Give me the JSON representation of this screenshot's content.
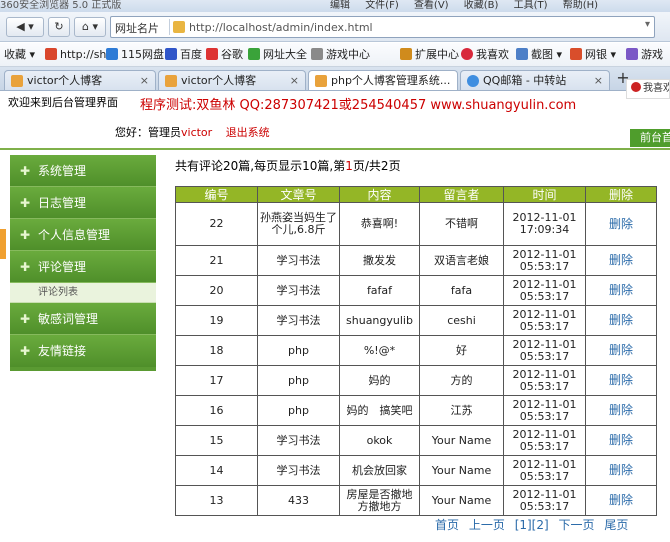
{
  "browser": {
    "app_title": "360安全浏览器 5.0 正式版",
    "menus": [
      "编辑",
      "文件(F)",
      "查看(V)",
      "收藏(B)",
      "工具(T)",
      "帮助(H)"
    ],
    "back_label": "◀",
    "home_label": "⌂",
    "sites_label": "网址名片",
    "address": "http://localhost/admin/index.html",
    "bookmarks": [
      "收藏",
      "http://sh",
      "115网盘",
      "百度",
      "谷歌",
      "网址大全",
      "游戏中心",
      "扩展中心",
      "我喜欢",
      "截图",
      "网银",
      "游戏"
    ],
    "tabs": [
      {
        "label": "victor个人博客"
      },
      {
        "label": "victor个人博客"
      },
      {
        "label": "php个人博客管理系统..."
      },
      {
        "label": "QQ邮箱 - 中转站"
      }
    ],
    "new_tab": "+",
    "badge": "我喜欢"
  },
  "colors": {
    "accent_green": "#94b626",
    "sidebar_green": "#5a9a32",
    "red_text": "#cc0000",
    "link_blue": "#2a6aa9"
  },
  "header": {
    "welcome": "欢迎来到后台管理界面",
    "slogan": "程序测试:双鱼林 QQ:287307421或254540457  www.shuangyulin.com",
    "greeting": "您好：管理员",
    "username": "victor",
    "logout": "退出系统",
    "front_link": "前台首页"
  },
  "sidebar": {
    "items": [
      {
        "label": "系统管理"
      },
      {
        "label": "日志管理"
      },
      {
        "label": "个人信息管理"
      },
      {
        "label": "评论管理"
      },
      {
        "label": "敏感词管理"
      },
      {
        "label": "友情链接"
      }
    ],
    "sub_item": "评论列表"
  },
  "summary": {
    "prefix": "共有评论",
    "total": "20",
    "mid1": "篇,每页显示",
    "per_page": "10",
    "mid2": "篇,第",
    "page": "1",
    "mid3": "页/共",
    "pages": "2",
    "suffix": "页"
  },
  "table": {
    "headers": [
      "编号",
      "文章号",
      "内容",
      "留言者",
      "时间",
      "删除"
    ],
    "rows": [
      {
        "id": "22",
        "article": "孙燕姿当妈生了个儿,6.8斤",
        "content": "恭喜啊!",
        "author": "不错啊",
        "time": "2012-11-01 17:09:34",
        "action": "删除"
      },
      {
        "id": "21",
        "article": "学习书法",
        "content": "撒发发",
        "author": "双语言老娘",
        "time": "2012-11-01 05:53:17",
        "action": "删除"
      },
      {
        "id": "20",
        "article": "学习书法",
        "content": "fafaf",
        "author": "fafa",
        "time": "2012-11-01 05:53:17",
        "action": "删除"
      },
      {
        "id": "19",
        "article": "学习书法",
        "content": "shuangyulib",
        "author": "ceshi",
        "time": "2012-11-01 05:53:17",
        "action": "删除"
      },
      {
        "id": "18",
        "article": "php",
        "content": "%!@*",
        "author": "好",
        "time": "2012-11-01 05:53:17",
        "action": "删除"
      },
      {
        "id": "17",
        "article": "php",
        "content": "妈的",
        "author": "方的",
        "time": "2012-11-01 05:53:17",
        "action": "删除"
      },
      {
        "id": "16",
        "article": "php",
        "content": "妈的　搞笑吧",
        "author": "江苏",
        "time": "2012-11-01 05:53:17",
        "action": "删除"
      },
      {
        "id": "15",
        "article": "学习书法",
        "content": "okok",
        "author": "Your Name",
        "time": "2012-11-01 05:53:17",
        "action": "删除"
      },
      {
        "id": "14",
        "article": "学习书法",
        "content": "机会放回家",
        "author": "Your Name",
        "time": "2012-11-01 05:53:17",
        "action": "删除"
      },
      {
        "id": "13",
        "article": "433",
        "content": "房屋是否撤地方撤地方",
        "author": "Your Name",
        "time": "2012-11-01 05:53:17",
        "action": "删除"
      }
    ]
  },
  "pager": {
    "first": "首页",
    "prev": "上一页",
    "pages": "[1][2]",
    "next": "下一页",
    "last": "尾页"
  }
}
